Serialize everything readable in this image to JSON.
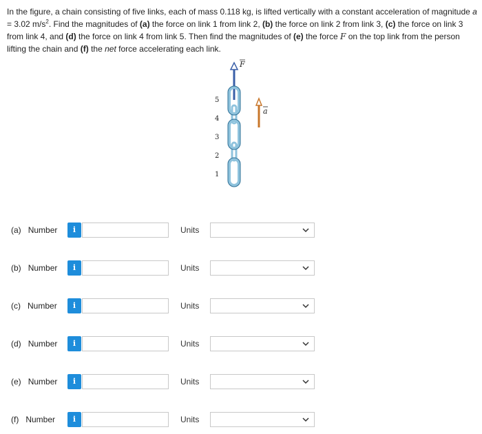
{
  "problem": {
    "p1": "In the figure, a chain consisting of five links, each of mass 0.118 kg, is lifted vertically with a constant acceleration of magnitude ",
    "a_var": "a",
    "p2": " = 3.02 m/s",
    "sq": "2",
    "p3": ". Find the magnitudes of ",
    "a_lbl": "(a)",
    "p4": " the force on link 1 from link 2, ",
    "b_lbl": "(b)",
    "p5": " the force on link 2 from link 3, ",
    "c_lbl": "(c)",
    "p6": " the force on link 3 from link 4, and ",
    "d_lbl": "(d)",
    "p7": " the force on link 4 from link 5. Then find the magnitudes of ",
    "e_lbl": "(e)",
    "p8": " the force ",
    "F_var": "F",
    "p9": " on the top link from the person lifting the chain and ",
    "f_lbl": "(f)",
    "p10": " the ",
    "net": "net",
    "p11": " force accelerating each link."
  },
  "figure": {
    "force_label": "F",
    "accel_label": "a",
    "link_labels": [
      "5",
      "4",
      "3",
      "2",
      "1"
    ],
    "chain_color": "#8fc3dd",
    "force_arrow_color": "#3a5fa8",
    "accel_arrow_color": "#c8762a"
  },
  "rows": [
    {
      "part": "(a)",
      "num_label": "Number",
      "info": "i",
      "value": "",
      "units_label": "Units",
      "unit_value": ""
    },
    {
      "part": "(b)",
      "num_label": "Number",
      "info": "i",
      "value": "",
      "units_label": "Units",
      "unit_value": ""
    },
    {
      "part": "(c)",
      "num_label": "Number",
      "info": "i",
      "value": "",
      "units_label": "Units",
      "unit_value": ""
    },
    {
      "part": "(d)",
      "num_label": "Number",
      "info": "i",
      "value": "",
      "units_label": "Units",
      "unit_value": ""
    },
    {
      "part": "(e)",
      "num_label": "Number",
      "info": "i",
      "value": "",
      "units_label": "Units",
      "unit_value": ""
    },
    {
      "part": "(f)",
      "num_label": "Number",
      "info": "i",
      "value": "",
      "units_label": "Units",
      "unit_value": ""
    }
  ]
}
